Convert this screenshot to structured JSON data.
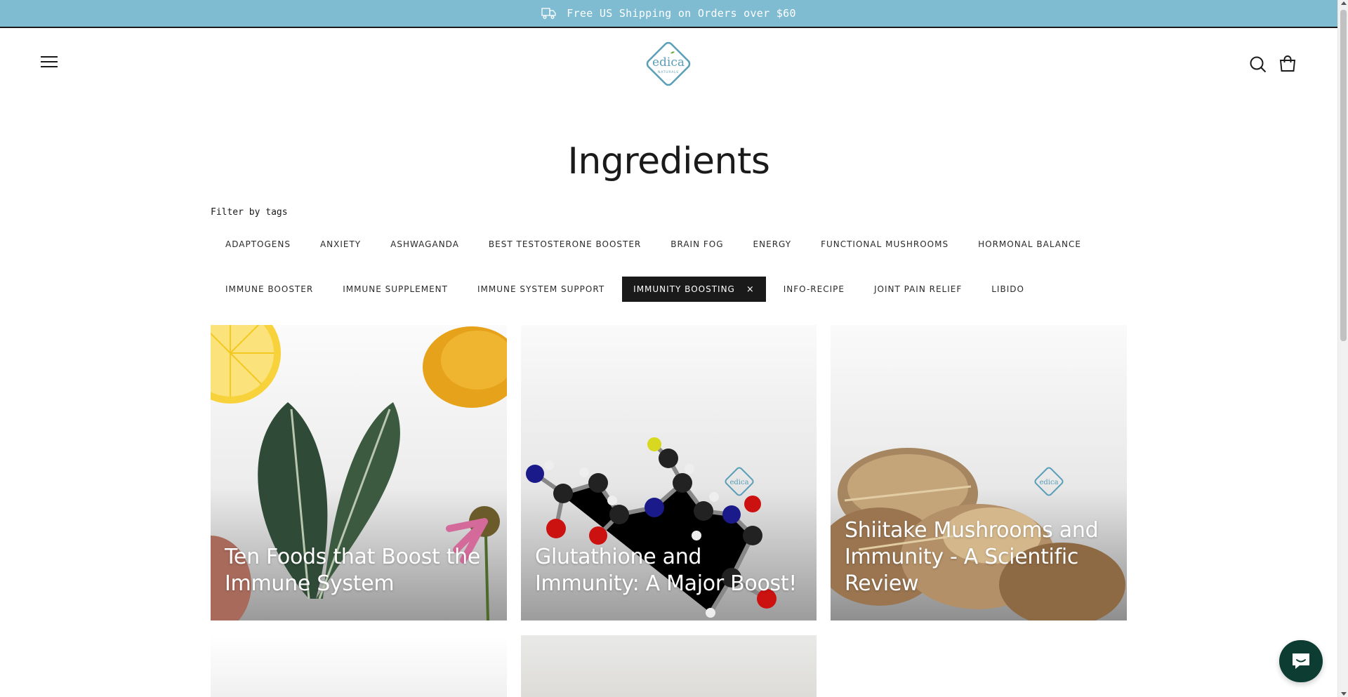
{
  "announcement": {
    "text": "Free US Shipping on Orders over $60",
    "icon": "truck-icon"
  },
  "header": {
    "logo_text": "edica",
    "logo_subtext": "NATURALS",
    "menu_icon": "hamburger-menu-icon",
    "search_icon": "search-icon",
    "cart_icon": "shopping-bag-icon"
  },
  "page": {
    "title": "Ingredients"
  },
  "filters": {
    "label": "Filter by tags",
    "tags": [
      {
        "label": "ADAPTOGENS",
        "active": false
      },
      {
        "label": "ANXIETY",
        "active": false
      },
      {
        "label": "ASHWAGANDA",
        "active": false
      },
      {
        "label": "BEST TESTOSTERONE BOOSTER",
        "active": false
      },
      {
        "label": "BRAIN FOG",
        "active": false
      },
      {
        "label": "ENERGY",
        "active": false
      },
      {
        "label": "FUNCTIONAL MUSHROOMS",
        "active": false
      },
      {
        "label": "HORMONAL BALANCE",
        "active": false
      },
      {
        "label": "IMMUNE BOOSTER",
        "active": false
      },
      {
        "label": "IMMUNE SUPPLEMENT",
        "active": false
      },
      {
        "label": "IMMUNE SYSTEM SUPPORT",
        "active": false
      },
      {
        "label": "IMMUNITY BOOSTING",
        "active": true,
        "remove_glyph": "×"
      },
      {
        "label": "INFO-RECIPE",
        "active": false
      },
      {
        "label": "JOINT PAIN RELIEF",
        "active": false
      },
      {
        "label": "LIBIDO",
        "active": false
      }
    ]
  },
  "articles": [
    {
      "title": "Ten Foods that Boost the Immune System"
    },
    {
      "title": "Glutathione and Immunity: A Major Boost!"
    },
    {
      "title": "Shiitake Mushrooms and Immunity - A Scientific Review"
    }
  ],
  "colors": {
    "announcement_bg": "#7fbcd2",
    "brand_teal": "#5a9eb8",
    "active_tag_bg": "#1a1a1a",
    "chat_bg": "#0d3c32"
  },
  "chat": {
    "icon": "chat-bubble-icon"
  }
}
